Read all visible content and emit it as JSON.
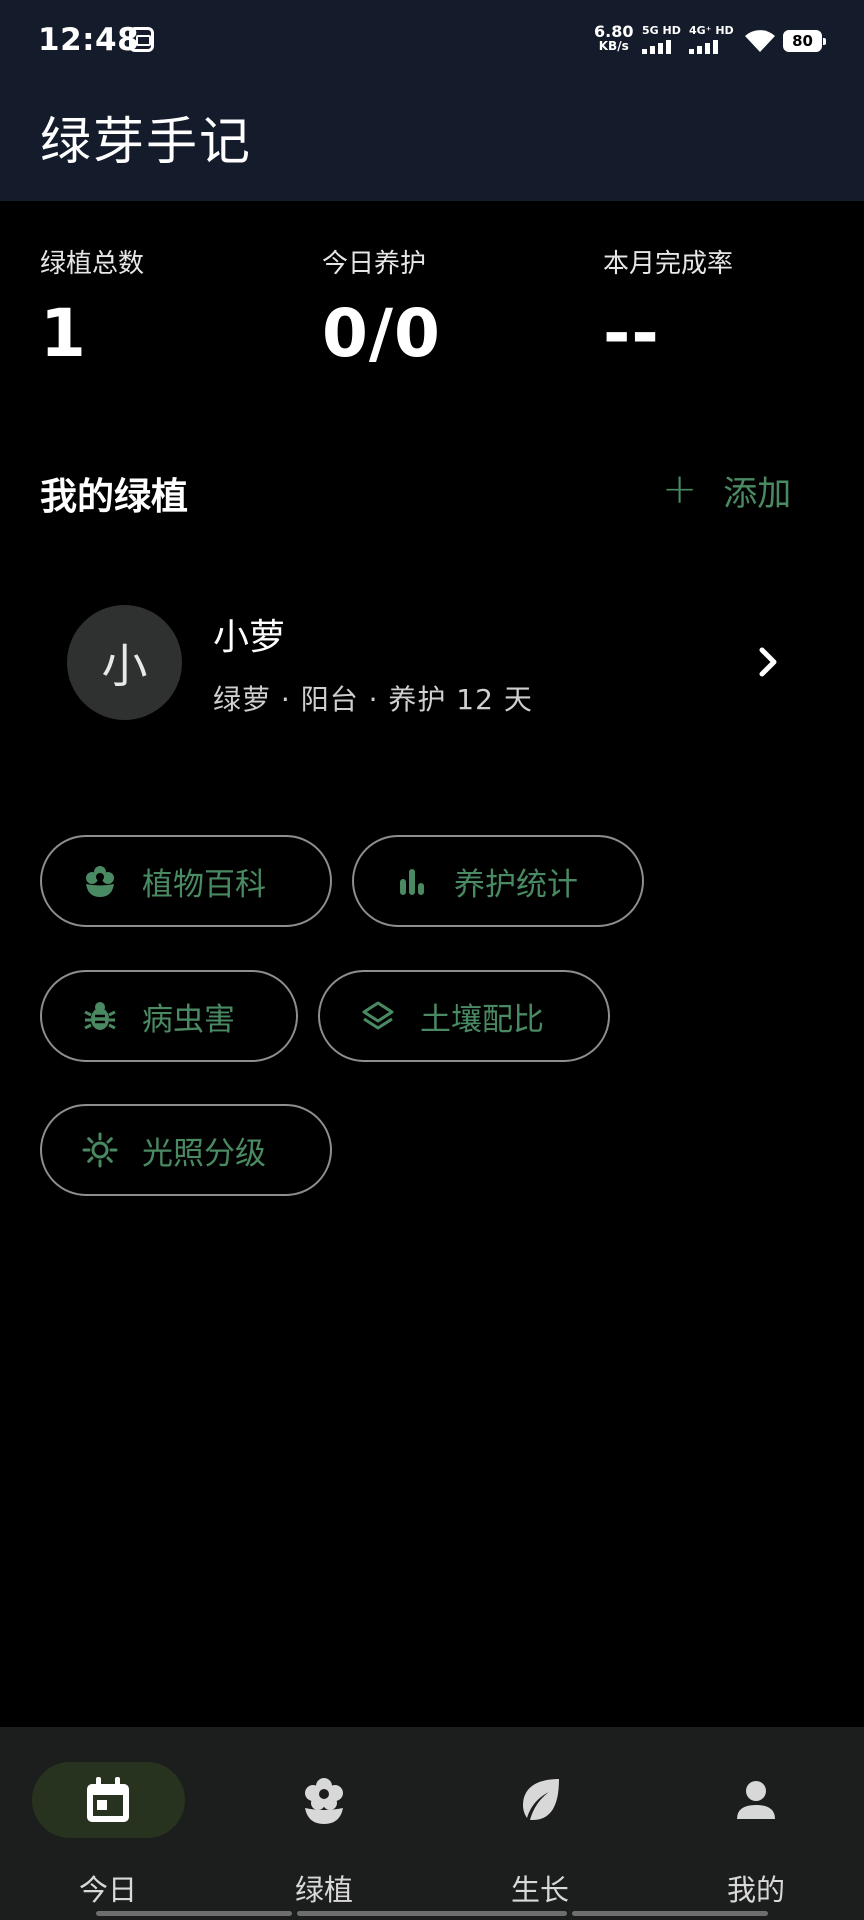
{
  "status_bar": {
    "time": "12:48",
    "net_speed": "6.80",
    "net_unit": "KB/s",
    "sim1": "5G HD",
    "sim2": "4G⁺ HD",
    "battery": "80",
    "icons": [
      "notification-icon",
      "signal-icon",
      "wifi-icon",
      "battery-icon"
    ]
  },
  "app_bar": {
    "title": "绿芽手记"
  },
  "stats": [
    {
      "label": "绿植总数",
      "value": "1"
    },
    {
      "label": "今日养护",
      "value": "0/0"
    },
    {
      "label": "本月完成率",
      "value": "--"
    }
  ],
  "plants_section": {
    "title": "我的绿植",
    "add_icon": "+",
    "add_label": "添加"
  },
  "plants": [
    {
      "avatar": "小",
      "name": "小萝",
      "meta": "绿萝 · 阳台 · 养护 12 天"
    }
  ],
  "chips": [
    {
      "label": "植物百科",
      "icon": "flower-icon"
    },
    {
      "label": "养护统计",
      "icon": "bar-chart-icon"
    },
    {
      "label": "病虫害",
      "icon": "bug-icon"
    },
    {
      "label": "土壤配比",
      "icon": "layers-icon"
    },
    {
      "label": "光照分级",
      "icon": "sun-icon"
    }
  ],
  "bottom_nav": [
    {
      "label": "今日",
      "icon": "calendar-icon",
      "active": true
    },
    {
      "label": "绿植",
      "icon": "flower-icon",
      "active": false
    },
    {
      "label": "生长",
      "icon": "leaf-icon",
      "active": false
    },
    {
      "label": "我的",
      "icon": "person-icon",
      "active": false
    }
  ],
  "colors": {
    "accent_green": "#4a8a63",
    "top_bar_bg": "#141b2b",
    "background": "#000000",
    "nav_bg": "#1c1d1d",
    "nav_active_bg": "#27331f"
  }
}
